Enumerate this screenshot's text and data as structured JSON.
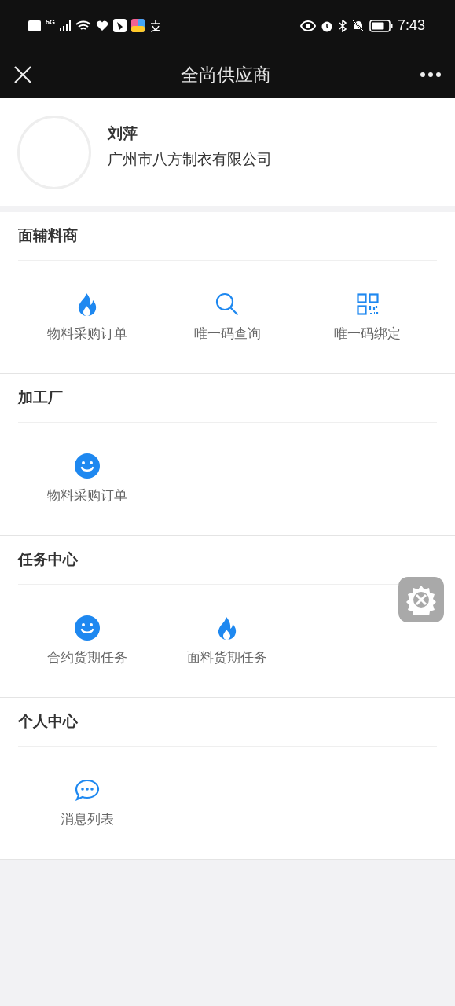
{
  "status_bar": {
    "time": "7:43",
    "network": "5G"
  },
  "nav": {
    "title": "全尚供应商"
  },
  "profile": {
    "name": "刘萍",
    "company": "广州市八方制衣有限公司"
  },
  "sections": [
    {
      "title": "面辅料商",
      "items": [
        {
          "kind": "fire",
          "label": "物料采购订单"
        },
        {
          "kind": "search",
          "label": "唯一码查询"
        },
        {
          "kind": "qrcode",
          "label": "唯一码绑定"
        }
      ]
    },
    {
      "title": "加工厂",
      "items": [
        {
          "kind": "smile",
          "label": "物料采购订单"
        }
      ]
    },
    {
      "title": "任务中心",
      "items": [
        {
          "kind": "smile",
          "label": "合约货期任务"
        },
        {
          "kind": "fire",
          "label": "面料货期任务"
        }
      ]
    },
    {
      "title": "个人中心",
      "items": [
        {
          "kind": "chat",
          "label": "消息列表"
        }
      ]
    }
  ]
}
